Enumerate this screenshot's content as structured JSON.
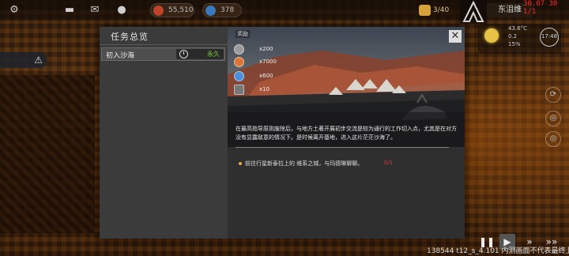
{
  "topbar": {
    "resource_gold": "55,510",
    "resource_blue": "378",
    "population": "3/40",
    "location": "东沮维",
    "datetime": "30.07 30 1/1"
  },
  "weather": {
    "temperature": "43.6°C",
    "wind": "0.2",
    "humidity": "15%",
    "clock": "17:48"
  },
  "modal": {
    "title": "任务总览",
    "quests": [
      {
        "name": "初入沙海",
        "tag": "永久"
      }
    ],
    "reward_label": "奖励",
    "rewards": [
      {
        "icon": "reputation-icon",
        "amount": "x200",
        "color": "#9a9a9a"
      },
      {
        "icon": "coin-icon",
        "amount": "x7000",
        "color": "#d9763a"
      },
      {
        "icon": "gear-token-icon",
        "amount": "x600",
        "color": "#4a90d9"
      },
      {
        "icon": "supply-icon",
        "amount": "x10",
        "color": "#777777"
      }
    ],
    "description": "在最高指导原则废除后，与地方土著开展初步交流是较为通行的工作切入点，尤其是在对方没有显露敌意的情况下。是时候离开基地，进入这片茫茫沙海了。",
    "objective": {
      "text": "前往行星新泰拉上的 维系之城，与玛德琳聊聊。",
      "progress": "0/1"
    }
  },
  "watermark": "138544 t12_s_4.101 内测画面不代表最终上线品质",
  "colors": {
    "accent_gold": "#e0b03a",
    "permanent_green": "#7ccf3a",
    "progress_red": "#d43a3a"
  }
}
